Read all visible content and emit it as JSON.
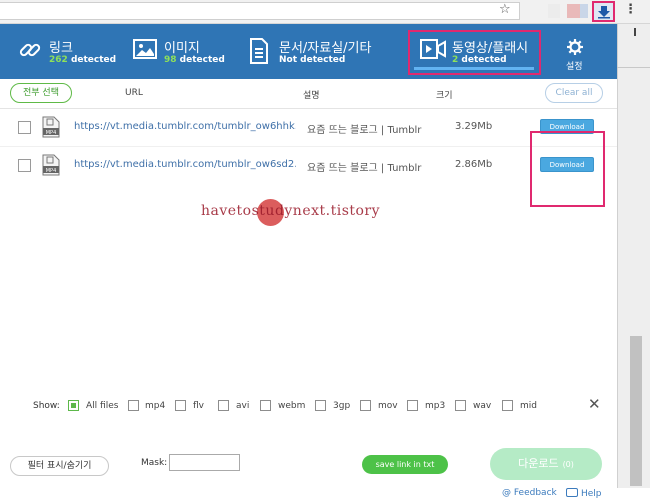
{
  "header": {
    "link": {
      "title": "링크",
      "count": "262",
      "suffix": "detected"
    },
    "image": {
      "title": "이미지",
      "count": "98",
      "suffix": "detected"
    },
    "docs": {
      "title": "문서/자료실/기타",
      "status": "Not detected"
    },
    "video": {
      "title": "동영상/플래시",
      "count": "2",
      "suffix": "detected"
    },
    "settings": {
      "label": "설정"
    }
  },
  "list_header": {
    "select_all": "전부 선택",
    "url": "URL",
    "description": "설명",
    "size": "크기",
    "clear_all": "Clear all"
  },
  "rows": [
    {
      "url": "https://vt.media.tumblr.com/tumblr_ow6hhk…",
      "description": "요즘 뜨는 블로그 | Tumblr",
      "size": "3.29Mb",
      "button": "Download",
      "file_type": "MP4"
    },
    {
      "url": "https://vt.media.tumblr.com/tumblr_ow6sd2…",
      "description": "요즘 뜨는 블로그 | Tumblr",
      "size": "2.86Mb",
      "button": "Download",
      "file_type": "MP4"
    }
  ],
  "watermark": "havetostudynext.tistory",
  "filters": {
    "show_label": "Show:",
    "options": [
      "All files",
      "mp4",
      "flv",
      "avi",
      "webm",
      "3gp",
      "mov",
      "mp3",
      "wav",
      "mid"
    ],
    "checked": "All files"
  },
  "footer": {
    "filter_toggle": "필터 표시/숨기기",
    "mask_label": "Mask:",
    "mask_value": "",
    "save_link": "save link in txt",
    "download_label": "다운로드",
    "download_count": "(0)",
    "feedback": "Feedback",
    "help": "Help"
  },
  "colors": {
    "header_bg": "#2f75b5",
    "accent_green": "#4dc248",
    "highlight": "#e0296f",
    "detect_count": "#8ee05a"
  }
}
